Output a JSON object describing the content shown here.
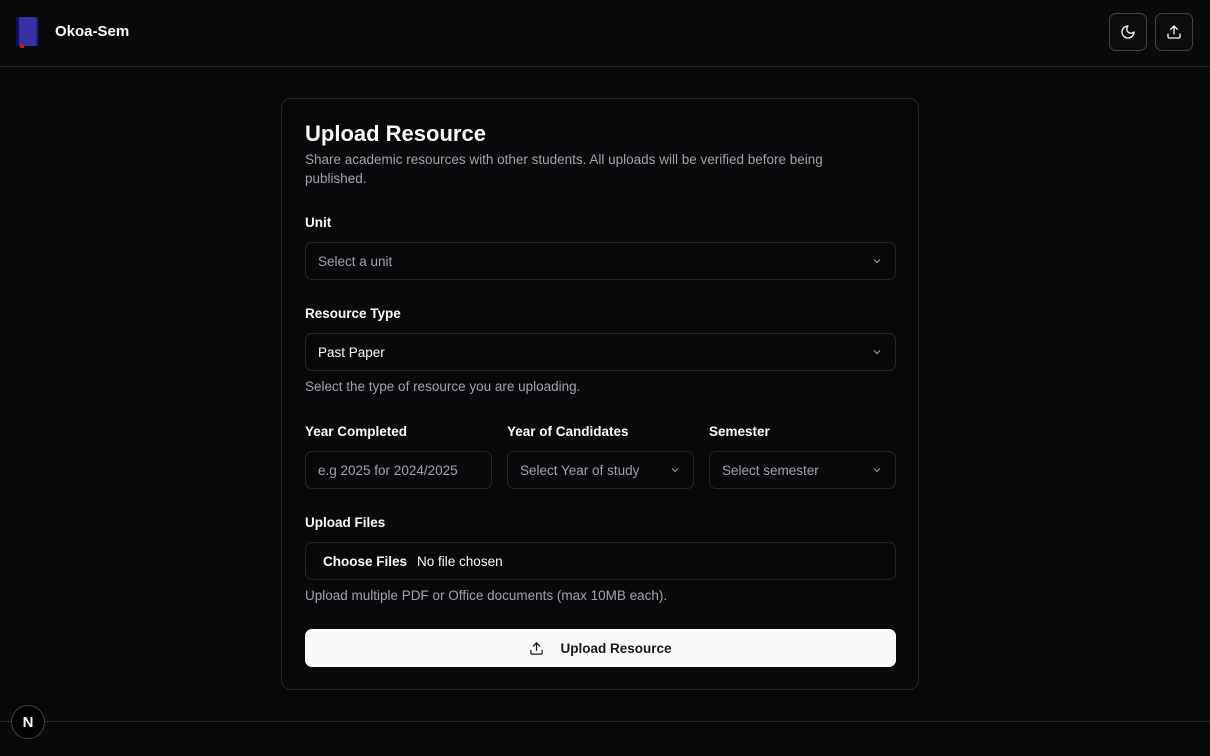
{
  "header": {
    "brand": "Okoa-Sem",
    "theme_toggle_icon": "moon-icon",
    "upload_icon": "upload-icon"
  },
  "form": {
    "title": "Upload Resource",
    "description": "Share academic resources with other students. All uploads will be verified before being published.",
    "unit": {
      "label": "Unit",
      "placeholder": "Select a unit"
    },
    "resource_type": {
      "label": "Resource Type",
      "value": "Past Paper",
      "hint": "Select the type of resource you are uploading."
    },
    "year_completed": {
      "label": "Year Completed",
      "placeholder": "e.g 2025 for 2024/2025"
    },
    "year_of_candidates": {
      "label": "Year of Candidates",
      "placeholder": "Select Year of study"
    },
    "semester": {
      "label": "Semester",
      "placeholder": "Select semester"
    },
    "files": {
      "label": "Upload Files",
      "button": "Choose Files",
      "status": "No file chosen",
      "hint": "Upload multiple PDF or Office documents (max 10MB each)."
    },
    "submit_label": "Upload Resource"
  },
  "badge": {
    "letter": "N"
  },
  "colors": {
    "background": "#09090b",
    "border": "#27272a",
    "muted_text": "#a1a1aa",
    "primary_button": "#fafafa"
  }
}
